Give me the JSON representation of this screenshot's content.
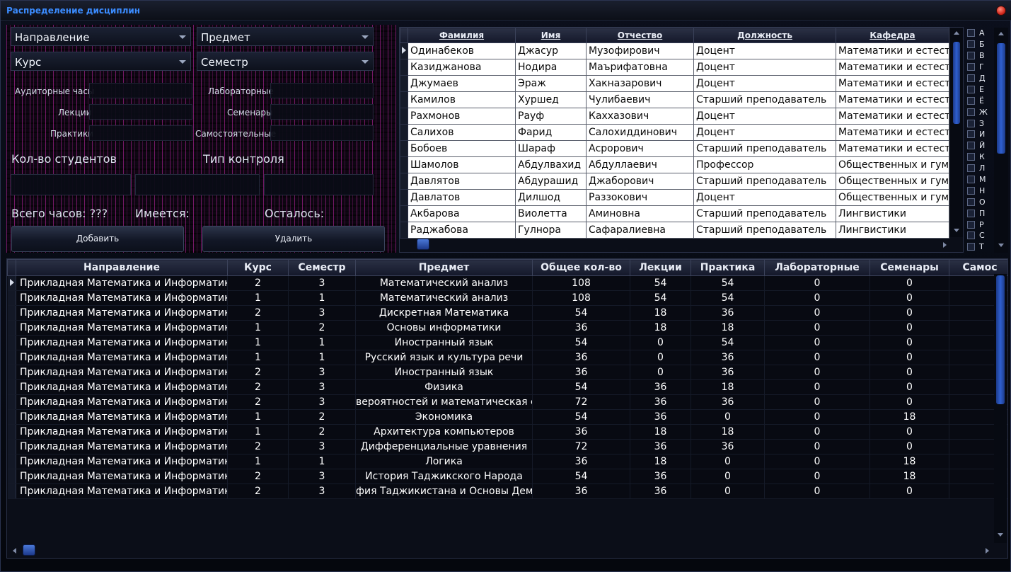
{
  "window": {
    "title": "Распределение дисциплин"
  },
  "form": {
    "direction_placeholder": "Направление",
    "subject_placeholder": "Предмет",
    "course_placeholder": "Курс",
    "semester_placeholder": "Семестр",
    "auditory_hours_label": "Аудиторные часы",
    "lab_label": "Лабораторные",
    "lectures_label": "Лекции",
    "seminars_label": "Семенары",
    "practices_label": "Практики",
    "independent_label": "Самостоятельные",
    "students_count_label": "Кол-во студентов",
    "control_type_label": "Тип контроля",
    "total_hours_label": "Всего часов: ???",
    "available_label": "Имеется:",
    "remaining_label": "Осталось:",
    "add_button": "Добавить",
    "delete_button": "Удалить"
  },
  "teachers": {
    "columns": [
      "Фамилия",
      "Имя",
      "Отчество",
      "Должность",
      "Кафедра"
    ],
    "rows": [
      [
        "Одинабеков",
        "Джасур",
        "Музофирович",
        "Доцент",
        "Математики и естестве"
      ],
      [
        "Казиджанова",
        "Нодира",
        "Маърифатовна",
        "Доцент",
        "Математики и естестве"
      ],
      [
        "Джумаев",
        "Эраж",
        "Хакназарович",
        "Доцент",
        "Математики и естестве"
      ],
      [
        "Камилов",
        "Хуршед",
        "Чулибаевич",
        "Старший преподаватель",
        "Математики и естестве"
      ],
      [
        "Рахмонов",
        "Рауф",
        "Каххазович",
        "Доцент",
        "Математики и естестве"
      ],
      [
        "Салихов",
        "Фарид",
        "Салохиддинович",
        "Доцент",
        "Математики и естестве"
      ],
      [
        "Бобоев",
        "Шараф",
        "Асрорович",
        "Старший преподаватель",
        "Математики и естестве"
      ],
      [
        "Шамолов",
        "Абдулвахид",
        "Абдуллаевич",
        "Профессор",
        "Общественных и гуман"
      ],
      [
        "Давлятов",
        "Абдурашид",
        "Джаборович",
        "Старший преподаватель",
        "Общественных и гуман"
      ],
      [
        "Давлатов",
        "Дилшод",
        "Раззокович",
        "Доцент",
        "Общественных и гуман"
      ],
      [
        "Акбарова",
        "Виолетта",
        "Аминовна",
        "Старший преподаватель",
        "Лингвистики"
      ],
      [
        "Раджабова",
        "Гулнора",
        "Сафаралиевна",
        "Старший преподаватель",
        "Лингвистики"
      ]
    ]
  },
  "alphabet": [
    "А",
    "Б",
    "В",
    "Г",
    "Д",
    "Е",
    "Ё",
    "Ж",
    "З",
    "И",
    "Й",
    "К",
    "Л",
    "М",
    "Н",
    "О",
    "П",
    "Р",
    "С",
    "Т"
  ],
  "disciplines": {
    "columns": [
      "Направление",
      "Курс",
      "Семестр",
      "Предмет",
      "Общее кол-во",
      "Лекции",
      "Практика",
      "Лабораторные",
      "Семенары",
      "Самос"
    ],
    "rows": [
      [
        "Прикладная Математика и  Информатика",
        "2",
        "3",
        "Математический анализ",
        "108",
        "54",
        "54",
        "0",
        "0"
      ],
      [
        "Прикладная Математика и  Информатика",
        "1",
        "1",
        "Математический анализ",
        "108",
        "54",
        "54",
        "0",
        "0"
      ],
      [
        "Прикладная Математика и  Информатика",
        "2",
        "3",
        "Дискретная Математика",
        "54",
        "18",
        "36",
        "0",
        "0"
      ],
      [
        "Прикладная Математика и  Информатика",
        "1",
        "2",
        "Основы информатики",
        "36",
        "18",
        "18",
        "0",
        "0"
      ],
      [
        "Прикладная Математика и  Информатика",
        "1",
        "1",
        "Иностранный язык",
        "54",
        "0",
        "54",
        "0",
        "0"
      ],
      [
        "Прикладная Математика и  Информатика",
        "1",
        "1",
        "Русский язык и культура речи",
        "36",
        "0",
        "36",
        "0",
        "0"
      ],
      [
        "Прикладная Математика и  Информатика",
        "2",
        "3",
        "Иностранный язык",
        "36",
        "0",
        "36",
        "0",
        "0"
      ],
      [
        "Прикладная Математика и  Информатика",
        "2",
        "3",
        "Физика",
        "54",
        "36",
        "18",
        "0",
        "0"
      ],
      [
        "Прикладная Математика и  Информатика",
        "2",
        "3",
        "вероятностей и математическая ста",
        "72",
        "36",
        "36",
        "0",
        "0"
      ],
      [
        "Прикладная Математика и  Информатика",
        "1",
        "2",
        "Экономика",
        "54",
        "36",
        "0",
        "0",
        "18"
      ],
      [
        "Прикладная Математика и  Информатика",
        "1",
        "2",
        "Архитектура компьютеров",
        "36",
        "18",
        "18",
        "0",
        "0"
      ],
      [
        "Прикладная Математика и  Информатика",
        "2",
        "3",
        "Дифференциальные уравнения",
        "72",
        "36",
        "36",
        "0",
        "0"
      ],
      [
        "Прикладная Математика и  Информатика",
        "1",
        "1",
        "Логика",
        "36",
        "18",
        "0",
        "0",
        "18"
      ],
      [
        "Прикладная Математика и  Информатика",
        "2",
        "3",
        "История Таджикского Народа",
        "54",
        "36",
        "0",
        "0",
        "18"
      ],
      [
        "Прикладная Математика и  Информатика",
        "2",
        "3",
        "фия Таджикистана и Основы Демог",
        "36",
        "36",
        "0",
        "0",
        "0"
      ]
    ]
  }
}
